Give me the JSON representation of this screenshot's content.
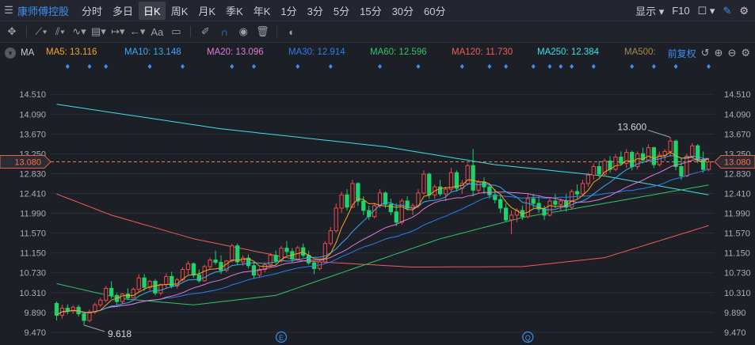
{
  "toolbar": {
    "stock_name": "康师傅控股",
    "periods": [
      "分时",
      "多日",
      "日K",
      "周K",
      "月K",
      "季K",
      "年K",
      "1分",
      "3分",
      "5分",
      "15分",
      "30分",
      "60分"
    ],
    "active_period": "日K",
    "display_label": "显示",
    "f10_label": "F10"
  },
  "drawing_tools": [
    "move-icon",
    "line-icon",
    "channel-icon",
    "wave-icon",
    "fib-icon",
    "range-icon",
    "arrow-icon",
    "text-icon",
    "note-icon",
    "eraser-icon",
    "magnet-icon",
    "eye-icon",
    "trash-icon",
    "toggle-icon"
  ],
  "ma_bar": {
    "title": "MA",
    "fq_label": "前复权",
    "items": [
      {
        "label": "MA5: 13.116",
        "color": "#f5a623"
      },
      {
        "label": "MA10: 13.148",
        "color": "#3fa9f5"
      },
      {
        "label": "MA20: 13.096",
        "color": "#e07ad8"
      },
      {
        "label": "MA30: 12.914",
        "color": "#2f7cf0"
      },
      {
        "label": "MA60: 12.596",
        "color": "#34c36b"
      },
      {
        "label": "MA120: 11.730",
        "color": "#f05b5b"
      },
      {
        "label": "MA250: 12.384",
        "color": "#3ee0e6"
      },
      {
        "label": "MA500:",
        "color": "#a58a4a"
      }
    ]
  },
  "chart_data": {
    "type": "candlestick",
    "ylim": [
      9.3,
      15.0
    ],
    "y_ticks": [
      "14.510",
      "14.090",
      "13.670",
      "13.250",
      "12.830",
      "12.410",
      "11.990",
      "11.570",
      "11.150",
      "10.730",
      "10.310",
      "9.890",
      "9.470"
    ],
    "current_price": "13.080",
    "annotations": {
      "high": "13.600",
      "low": "9.618"
    },
    "event_markers": [
      "E",
      "Q"
    ],
    "ohlc": [
      [
        10.08,
        10.12,
        9.72,
        9.83
      ],
      [
        9.83,
        10.05,
        9.76,
        9.98
      ],
      [
        9.98,
        10.06,
        9.85,
        9.92
      ],
      [
        9.92,
        10.04,
        9.86,
        10.0
      ],
      [
        10.0,
        10.05,
        9.8,
        9.86
      ],
      [
        9.86,
        9.9,
        9.62,
        9.72
      ],
      [
        9.72,
        9.95,
        9.68,
        9.9
      ],
      [
        9.9,
        10.1,
        9.85,
        10.05
      ],
      [
        10.05,
        10.2,
        10.0,
        10.15
      ],
      [
        10.15,
        10.45,
        10.1,
        10.4
      ],
      [
        10.4,
        10.55,
        10.18,
        10.25
      ],
      [
        10.25,
        10.3,
        10.05,
        10.12
      ],
      [
        10.12,
        10.3,
        10.08,
        10.28
      ],
      [
        10.28,
        10.4,
        10.15,
        10.2
      ],
      [
        10.2,
        10.42,
        10.18,
        10.38
      ],
      [
        10.38,
        10.7,
        10.32,
        10.62
      ],
      [
        10.62,
        10.7,
        10.35,
        10.42
      ],
      [
        10.42,
        10.58,
        10.36,
        10.55
      ],
      [
        10.55,
        10.6,
        10.25,
        10.3
      ],
      [
        10.3,
        10.5,
        10.25,
        10.48
      ],
      [
        10.48,
        10.72,
        10.4,
        10.65
      ],
      [
        10.65,
        10.75,
        10.4,
        10.45
      ],
      [
        10.45,
        10.62,
        10.4,
        10.58
      ],
      [
        10.58,
        10.85,
        10.55,
        10.8
      ],
      [
        10.8,
        10.98,
        10.7,
        10.92
      ],
      [
        10.92,
        10.95,
        10.62,
        10.68
      ],
      [
        10.68,
        10.8,
        10.52,
        10.56
      ],
      [
        10.56,
        10.9,
        10.54,
        10.86
      ],
      [
        10.86,
        11.05,
        10.8,
        11.0
      ],
      [
        11.0,
        11.2,
        10.9,
        10.95
      ],
      [
        10.95,
        11.1,
        10.7,
        10.78
      ],
      [
        10.78,
        11.0,
        10.74,
        10.98
      ],
      [
        10.98,
        11.35,
        10.95,
        11.3
      ],
      [
        11.3,
        11.35,
        10.9,
        10.96
      ],
      [
        10.96,
        11.1,
        10.88,
        11.04
      ],
      [
        11.04,
        11.12,
        10.82,
        10.88
      ],
      [
        10.88,
        10.96,
        10.6,
        10.68
      ],
      [
        10.68,
        10.85,
        10.62,
        10.8
      ],
      [
        10.8,
        10.95,
        10.74,
        10.9
      ],
      [
        10.9,
        11.15,
        10.86,
        11.1
      ],
      [
        11.1,
        11.2,
        10.92,
        10.98
      ],
      [
        10.98,
        11.3,
        10.95,
        11.25
      ],
      [
        11.25,
        11.4,
        11.1,
        11.18
      ],
      [
        11.18,
        11.25,
        10.95,
        11.02
      ],
      [
        11.02,
        11.3,
        10.98,
        11.26
      ],
      [
        11.26,
        11.35,
        11.05,
        11.1
      ],
      [
        11.1,
        11.2,
        10.9,
        10.94
      ],
      [
        10.94,
        10.98,
        10.7,
        10.82
      ],
      [
        10.82,
        11.0,
        10.78,
        10.96
      ],
      [
        10.96,
        11.4,
        10.92,
        11.35
      ],
      [
        11.35,
        11.7,
        11.3,
        11.62
      ],
      [
        11.62,
        12.2,
        11.58,
        12.1
      ],
      [
        12.1,
        12.45,
        12.0,
        12.38
      ],
      [
        12.38,
        12.5,
        12.05,
        12.12
      ],
      [
        12.12,
        12.7,
        12.1,
        12.62
      ],
      [
        12.62,
        12.65,
        12.15,
        12.25
      ],
      [
        12.25,
        12.35,
        11.95,
        12.05
      ],
      [
        12.05,
        12.15,
        11.85,
        11.92
      ],
      [
        11.92,
        12.2,
        11.88,
        12.15
      ],
      [
        12.15,
        12.5,
        12.1,
        12.42
      ],
      [
        12.42,
        12.45,
        12.1,
        12.18
      ],
      [
        12.18,
        12.3,
        11.95,
        12.02
      ],
      [
        12.02,
        12.2,
        11.72,
        11.8
      ],
      [
        11.8,
        12.3,
        11.75,
        12.25
      ],
      [
        12.25,
        12.35,
        12.05,
        12.1
      ],
      [
        12.1,
        12.2,
        11.95,
        12.15
      ],
      [
        12.15,
        12.5,
        12.1,
        12.42
      ],
      [
        12.42,
        12.9,
        12.38,
        12.82
      ],
      [
        12.82,
        12.85,
        12.3,
        12.38
      ],
      [
        12.38,
        12.6,
        12.3,
        12.55
      ],
      [
        12.55,
        12.7,
        12.35,
        12.4
      ],
      [
        12.4,
        12.55,
        12.25,
        12.5
      ],
      [
        12.5,
        12.95,
        12.45,
        12.85
      ],
      [
        12.85,
        12.9,
        12.45,
        12.52
      ],
      [
        12.52,
        12.7,
        12.4,
        12.62
      ],
      [
        12.62,
        13.05,
        12.58,
        13.0
      ],
      [
        13.0,
        13.35,
        12.35,
        12.48
      ],
      [
        12.48,
        12.7,
        12.42,
        12.65
      ],
      [
        12.65,
        12.75,
        12.4,
        12.55
      ],
      [
        12.55,
        12.6,
        12.3,
        12.38
      ],
      [
        12.38,
        12.5,
        12.2,
        12.28
      ],
      [
        12.28,
        12.4,
        12.0,
        12.1
      ],
      [
        12.1,
        12.2,
        11.8,
        11.85
      ],
      [
        11.85,
        12.05,
        11.55,
        11.95
      ],
      [
        11.95,
        12.1,
        11.8,
        12.05
      ],
      [
        12.05,
        12.15,
        11.85,
        11.92
      ],
      [
        11.92,
        12.4,
        11.88,
        12.3
      ],
      [
        12.3,
        12.4,
        12.1,
        12.2
      ],
      [
        12.2,
        12.35,
        12.0,
        12.08
      ],
      [
        12.08,
        12.15,
        11.85,
        11.95
      ],
      [
        11.95,
        12.3,
        11.92,
        12.25
      ],
      [
        12.25,
        12.4,
        12.1,
        12.18
      ],
      [
        12.18,
        12.3,
        12.05,
        12.25
      ],
      [
        12.25,
        12.4,
        12.02,
        12.12
      ],
      [
        12.12,
        12.5,
        12.08,
        12.45
      ],
      [
        12.45,
        12.6,
        12.3,
        12.4
      ],
      [
        12.4,
        12.7,
        12.35,
        12.62
      ],
      [
        12.62,
        12.85,
        12.55,
        12.8
      ],
      [
        12.8,
        13.05,
        12.7,
        12.98
      ],
      [
        12.98,
        13.1,
        12.75,
        12.82
      ],
      [
        12.82,
        13.15,
        12.78,
        13.1
      ],
      [
        13.1,
        13.2,
        12.85,
        12.92
      ],
      [
        12.92,
        13.25,
        12.88,
        13.18
      ],
      [
        13.18,
        13.3,
        13.0,
        13.05
      ],
      [
        13.05,
        13.35,
        12.95,
        13.28
      ],
      [
        13.28,
        13.32,
        12.9,
        12.98
      ],
      [
        12.98,
        13.3,
        12.92,
        13.25
      ],
      [
        13.25,
        13.38,
        13.05,
        13.12
      ],
      [
        13.12,
        13.45,
        13.08,
        13.38
      ],
      [
        13.38,
        13.4,
        12.95,
        13.02
      ],
      [
        13.02,
        13.3,
        12.98,
        13.22
      ],
      [
        13.22,
        13.35,
        13.1,
        13.3
      ],
      [
        13.3,
        13.6,
        13.2,
        13.52
      ],
      [
        13.52,
        13.55,
        12.9,
        12.98
      ],
      [
        12.98,
        13.15,
        12.7,
        12.78
      ],
      [
        12.78,
        13.25,
        12.75,
        13.2
      ],
      [
        13.2,
        13.48,
        13.15,
        13.42
      ],
      [
        13.42,
        13.46,
        13.05,
        13.12
      ],
      [
        13.12,
        13.3,
        12.85,
        12.92
      ],
      [
        12.92,
        13.15,
        12.88,
        13.08
      ]
    ],
    "ma_series": [
      {
        "name": "MA250",
        "color": "#3ee0e6",
        "points": [
          [
            0,
            14.3
          ],
          [
            30,
            13.78
          ],
          [
            60,
            13.4
          ],
          [
            80,
            13.02
          ],
          [
            100,
            12.78
          ],
          [
            119,
            12.38
          ]
        ]
      },
      {
        "name": "MA120",
        "color": "#f05b5b",
        "points": [
          [
            0,
            12.4
          ],
          [
            10,
            11.95
          ],
          [
            25,
            11.45
          ],
          [
            45,
            10.98
          ],
          [
            65,
            10.85
          ],
          [
            85,
            10.86
          ],
          [
            100,
            11.05
          ],
          [
            119,
            11.73
          ]
        ]
      },
      {
        "name": "MA60",
        "color": "#34c36b",
        "points": [
          [
            0,
            10.5
          ],
          [
            12,
            10.18
          ],
          [
            25,
            10.05
          ],
          [
            40,
            10.25
          ],
          [
            55,
            10.85
          ],
          [
            70,
            11.45
          ],
          [
            85,
            11.9
          ],
          [
            100,
            12.2
          ],
          [
            119,
            12.59
          ]
        ]
      }
    ]
  }
}
